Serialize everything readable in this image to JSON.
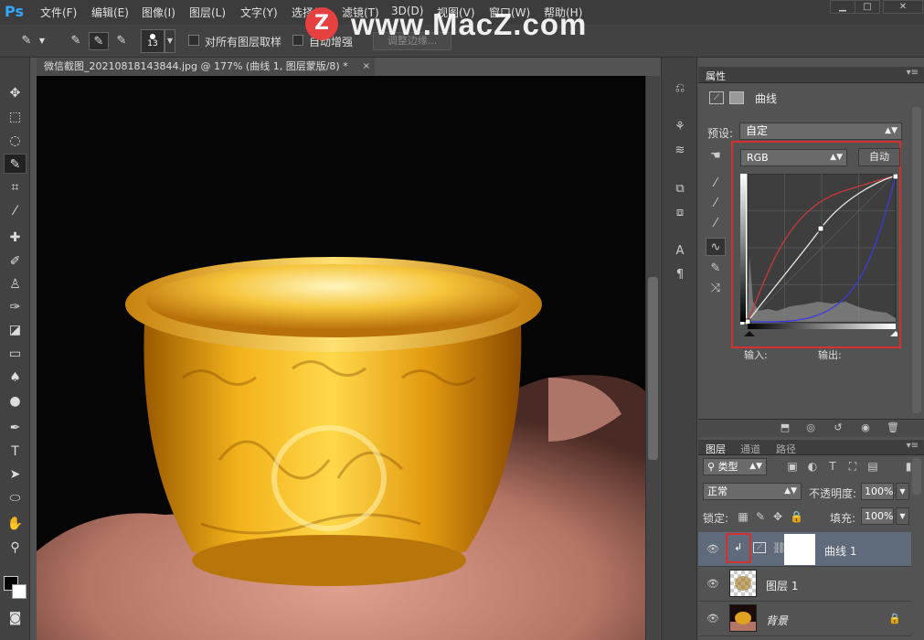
{
  "app": {
    "logo": "Ps",
    "menu": [
      "文件(F)",
      "编辑(E)",
      "图像(I)",
      "图层(L)",
      "文字(Y)",
      "选择(S)",
      "滤镜(T)",
      "3D(D)",
      "视图(V)",
      "窗口(W)",
      "帮助(H)"
    ],
    "window_buttons": {
      "minimize": "▁",
      "maximize": "□",
      "close": "✕"
    }
  },
  "watermark": {
    "logo": "Z",
    "text": "www.MacZ.com"
  },
  "options": {
    "brush_size": "13",
    "sample_all_layers_label": "对所有图层取样",
    "auto_enhance_label": "自动增强",
    "refine_edge_label": "调整边缘...",
    "sample_all_layers_checked": false,
    "auto_enhance_checked": false
  },
  "document": {
    "tab_title": "微信截图_20210818143844.jpg @ 177% (曲线 1, 图层蒙版/8) *",
    "close": "×"
  },
  "properties": {
    "tab": "属性",
    "title": "曲线",
    "preset_label": "预设:",
    "preset_value": "自定",
    "channel_value": "RGB",
    "auto_label": "自动",
    "input_label": "输入:",
    "output_label": "输出:"
  },
  "layers_panel": {
    "tabs": [
      "图层",
      "通道",
      "路径"
    ],
    "filter_value": "类型",
    "blend_mode": "正常",
    "opacity_label": "不透明度:",
    "opacity_value": "100%",
    "lock_label": "锁定:",
    "fill_label": "填充:",
    "fill_value": "100%",
    "layers": [
      {
        "name": "曲线 1",
        "selected": true
      },
      {
        "name": "图层 1",
        "selected": false
      },
      {
        "name": "背景",
        "selected": false
      }
    ]
  },
  "colors": {
    "accent_red": "#d43030",
    "ps_blue": "#31a8ff",
    "curve_white": "#e8e8e8",
    "curve_red": "#c83a3a",
    "curve_blue": "#3a3ae0"
  },
  "icons": {
    "eye": "eye-icon",
    "lock": "lock-icon",
    "link": "link-icon",
    "clip": "clipping-mask-icon"
  }
}
